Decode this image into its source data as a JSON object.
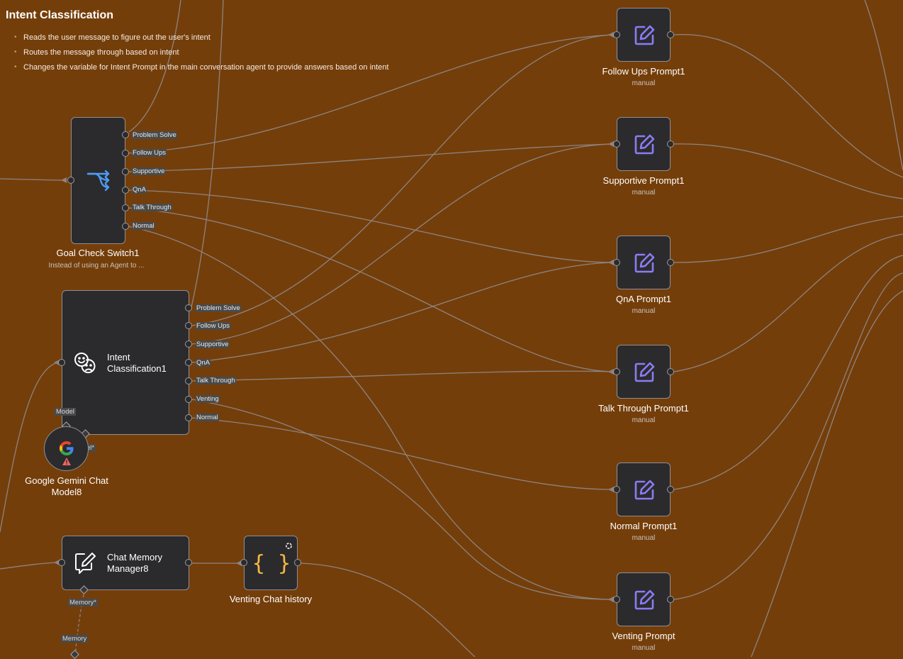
{
  "sticky": {
    "title": "Intent Classification",
    "bullets": [
      "Reads the user message to figure out the user's intent",
      "Routes the message through based on intent",
      "Changes the variable for Intent Prompt in the main conversation agent to provide answers based on intent"
    ]
  },
  "switch_node": {
    "name": "Goal Check Switch1",
    "note": "Instead of using an Agent to ...",
    "icon": "switch-route-icon",
    "outputs": [
      "Problem Solve",
      "Follow Ups",
      "Supportive",
      "QnA",
      "Talk Through",
      "Normal"
    ]
  },
  "classifier_node": {
    "name_line1": "Intent",
    "name_line2": "Classification1",
    "icon": "intent-faces-icon",
    "outputs": [
      "Problem Solve",
      "Follow Ups",
      "Supportive",
      "QnA",
      "Talk Through",
      "Venting",
      "Normal"
    ],
    "model_label": "Model",
    "model_label_hidden": "el*"
  },
  "gemini_node": {
    "name_line1": "Google Gemini Chat",
    "name_line2": "Model8",
    "icon": "google-logo-icon",
    "warning_icon": "warning-triangle-icon"
  },
  "memory_node": {
    "name_line1": "Chat Memory",
    "name_line2": "Manager8",
    "icon": "chat-edit-icon",
    "memory_required_label": "Memory*",
    "memory_label": "Memory"
  },
  "code_node": {
    "name": "Venting Chat history",
    "icon": "curly-braces-icon",
    "badge_icon": "refresh-badge-icon"
  },
  "prompt_nodes": [
    {
      "name": "Follow Ups Prompt1",
      "sub": "manual"
    },
    {
      "name": "Supportive Prompt1",
      "sub": "manual"
    },
    {
      "name": "QnA Prompt1",
      "sub": "manual"
    },
    {
      "name": "Talk Through Prompt1",
      "sub": "manual"
    },
    {
      "name": "Normal Prompt1",
      "sub": "manual"
    },
    {
      "name": "Venting Prompt",
      "sub": "manual"
    }
  ],
  "colors": {
    "canvas": "#743e0a",
    "node_bg": "#2b2b2d",
    "edit_icon": "#8b7cf6",
    "switch_icon": "#4e9bf5",
    "braces_icon": "#f5b642",
    "wire": "#8d8480"
  }
}
